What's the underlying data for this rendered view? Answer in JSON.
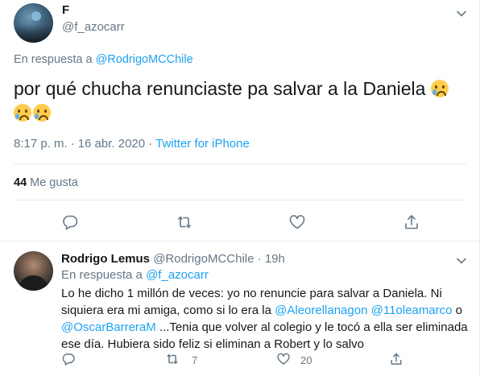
{
  "main_tweet": {
    "display_name": "F",
    "handle": "@f_azocarr",
    "reply_prefix": "En respuesta a",
    "reply_to": "@RodrigoMCChile",
    "text": "por qué chucha renunciaste pa salvar a la Daniela",
    "emoji_name": "crying-face",
    "time": "8:17 p. m.",
    "separator": "·",
    "date": "16 abr. 2020",
    "source": "Twitter for iPhone",
    "likes_count": "44",
    "likes_label": "Me gusta"
  },
  "reply": {
    "display_name": "Rodrigo Lemus",
    "handle": "@RodrigoMCChile",
    "separator": "·",
    "age": "19h",
    "reply_prefix": "En respuesta a",
    "reply_to": "@f_azocarr",
    "text_part1": "Lo he dicho 1 millón de veces: yo no renuncie para salvar a Daniela. Ni siquiera era mi amiga, como si lo era la",
    "mention1": "@Aleorellanagon",
    "mention2": "@11oleamarco",
    "text_or": "o",
    "mention3": "@OscarBarreraM",
    "text_part2": "...Tenia que volver al colegio y le tocó a ella ser eliminada ese día. Hubiera sido feliz si eliminan a Robert y lo salvo",
    "retweet_count": "7",
    "like_count": "20"
  },
  "colors": {
    "link": "#1da1f2",
    "muted": "#657786",
    "text": "#14171a",
    "divider": "#e6ecf0"
  }
}
